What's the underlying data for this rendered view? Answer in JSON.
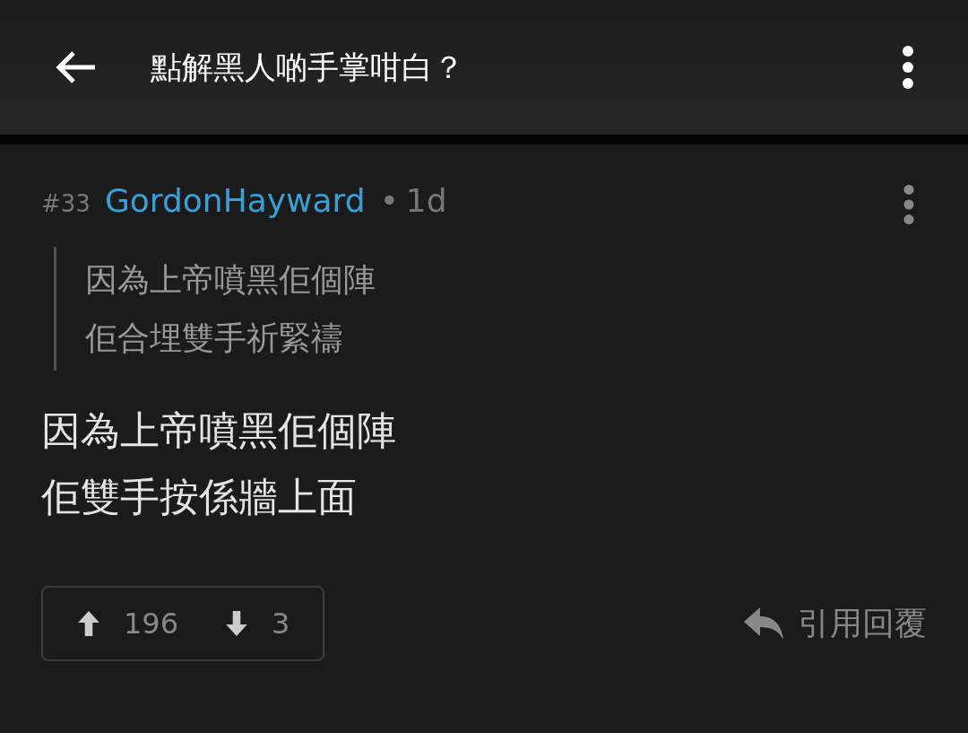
{
  "header": {
    "title": "點解黑人啲手掌咁白？"
  },
  "post": {
    "number": "#33",
    "author": "GordonHayward",
    "separator": "•",
    "time": "1d",
    "quote_lines": [
      "因為上帝噴黑佢個陣",
      "佢合埋雙手祈緊禱"
    ],
    "body_lines": [
      "因為上帝噴黑佢個陣",
      "佢雙手按係牆上面"
    ],
    "upvotes": "196",
    "downvotes": "3",
    "reply_label": "引用回覆"
  }
}
